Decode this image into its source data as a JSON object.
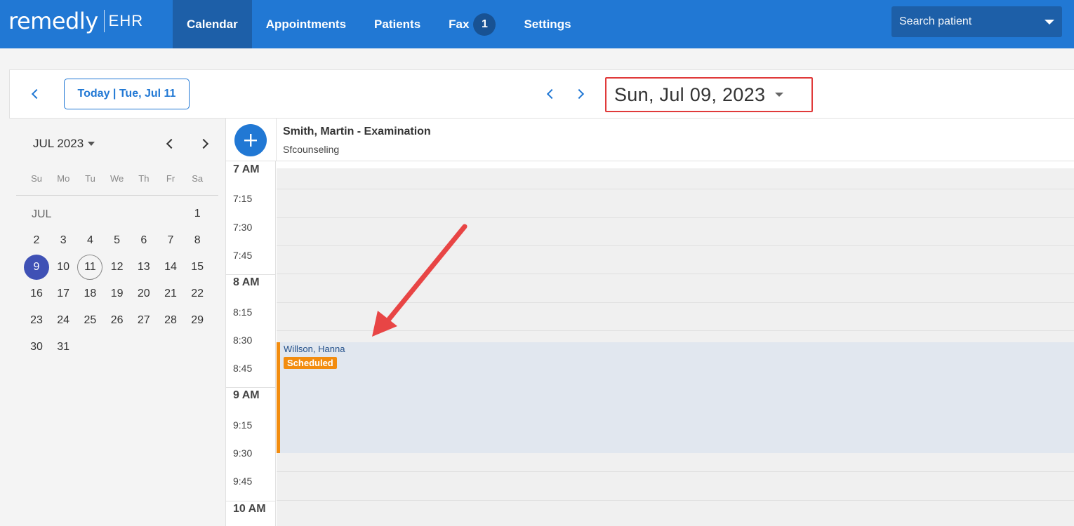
{
  "app": {
    "logo_main": "remedly",
    "logo_sub": "EHR"
  },
  "nav": {
    "items": [
      {
        "label": "Calendar",
        "active": true
      },
      {
        "label": "Appointments"
      },
      {
        "label": "Patients"
      },
      {
        "label": "Fax",
        "badge": "1"
      },
      {
        "label": "Settings"
      }
    ]
  },
  "search": {
    "placeholder": "Search patient"
  },
  "toolbar": {
    "today_label": "Today | Tue, Jul 11",
    "current_date": "Sun, Jul 09, 2023"
  },
  "minical": {
    "month_label": "JUL 2023",
    "dow": [
      "Su",
      "Mo",
      "Tu",
      "We",
      "Th",
      "Fr",
      "Sa"
    ],
    "month_abbr": "JUL",
    "selected_day": "9",
    "today_day": "11",
    "weeks": [
      [
        "",
        "",
        "",
        "",
        "",
        "",
        "1"
      ],
      [
        "2",
        "3",
        "4",
        "5",
        "6",
        "7",
        "8"
      ],
      [
        "9",
        "10",
        "11",
        "12",
        "13",
        "14",
        "15"
      ],
      [
        "16",
        "17",
        "18",
        "19",
        "20",
        "21",
        "22"
      ],
      [
        "23",
        "24",
        "25",
        "26",
        "27",
        "28",
        "29"
      ],
      [
        "30",
        "31",
        "",
        "",
        "",
        "",
        ""
      ]
    ]
  },
  "resource": {
    "title": "Smith, Martin - Examination",
    "subtitle": "Sfcounseling"
  },
  "times": [
    {
      "label": "7 AM",
      "hour": true
    },
    {
      "label": "7:15"
    },
    {
      "label": "7:30"
    },
    {
      "label": "7:45"
    },
    {
      "label": "8 AM",
      "hour": true
    },
    {
      "label": "8:15"
    },
    {
      "label": "8:30"
    },
    {
      "label": "8:45"
    },
    {
      "label": "9 AM",
      "hour": true
    },
    {
      "label": "9:15"
    },
    {
      "label": "9:30"
    },
    {
      "label": "9:45"
    },
    {
      "label": "10 AM",
      "hour": true
    }
  ],
  "appointment": {
    "patient": "Willson, Hanna",
    "status": "Scheduled"
  },
  "colors": {
    "brand": "#2178d4",
    "nav_active": "#1d5fa8",
    "status_scheduled": "#f28c0f",
    "highlight_box": "#e03a3a",
    "selected_day": "#3f51b5"
  }
}
